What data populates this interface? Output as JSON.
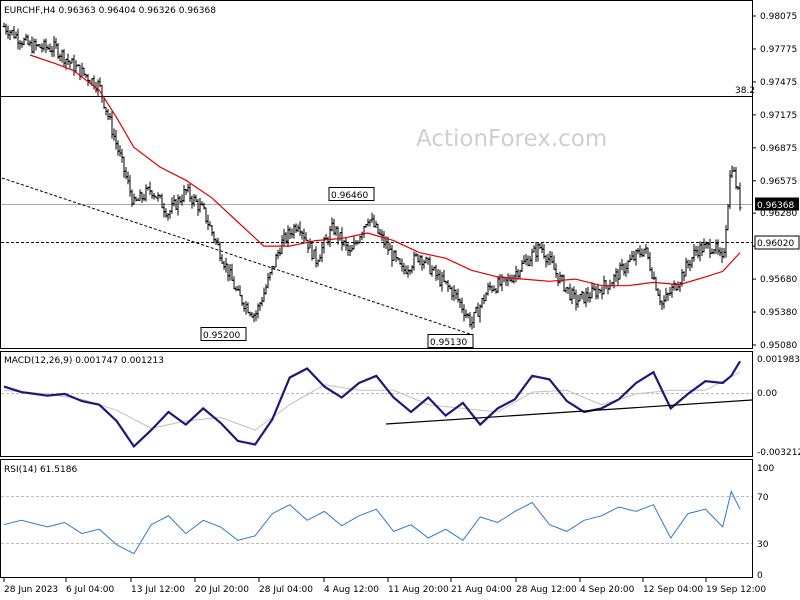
{
  "chart_data": [
    {
      "type": "candlestick",
      "panel": "price",
      "title": "EURCHF,H4  0.96363 0.96404 0.96326 0.96368",
      "watermark": "ActionForex.com",
      "y_ticks": [
        "0.98075",
        "0.97775",
        "0.97475",
        "0.97175",
        "0.96875",
        "0.96575",
        "0.96280",
        "0.95980",
        "0.95680",
        "0.95380",
        "0.95080"
      ],
      "ylim": [
        0.9508,
        0.9815
      ],
      "current_price": "0.96368",
      "annotations": [
        {
          "text": "0.96460",
          "value": 0.9646
        },
        {
          "text": "0.95200",
          "value": 0.952
        },
        {
          "text": "0.95130",
          "value": 0.9513
        },
        {
          "text": "0.96020",
          "value": 0.9602
        },
        {
          "text": "38.2",
          "value": 0.9737
        }
      ],
      "horizontal_lines": [
        {
          "value": 0.9737,
          "style": "solid",
          "label": "38.2"
        },
        {
          "value": 0.9602,
          "style": "dashed",
          "label": "0.96020"
        }
      ],
      "trendline": {
        "from": {
          "date": "28 Jun 2023",
          "value": 0.9655
        },
        "to": {
          "date": "25 Aug 2023",
          "value": 0.9513
        },
        "style": "dashed"
      },
      "moving_average_color": "#e00000",
      "candle_color": "#000000"
    },
    {
      "type": "line",
      "panel": "macd",
      "title": "MACD(12,26,9) 0.001747 0.001213",
      "y_ticks": [
        "0.001983",
        "0.00",
        "-0.003212"
      ],
      "ylim": [
        -0.00335,
        0.00215
      ],
      "macd_color": "#1a1a7a",
      "signal_color": "#c0c0c0",
      "trendline": {
        "from": {
          "date": "9 Aug 2023",
          "value": -0.0022
        },
        "to": {
          "date": "21 Sep 2023",
          "value": -0.0006
        }
      }
    },
    {
      "type": "line",
      "panel": "rsi",
      "title": "RSI(14) 61.5186",
      "y_ticks": [
        "100",
        "70",
        "30",
        "0"
      ],
      "ylim": [
        0,
        100
      ],
      "levels": [
        70,
        30
      ],
      "line_color": "#2b7bc8"
    }
  ],
  "x_axis": {
    "ticks": [
      "28 Jun 2023",
      "6 Jul 04:00",
      "13 Jul 12:00",
      "20 Jul 20:00",
      "28 Jul 04:00",
      "4 Aug 12:00",
      "11 Aug 20:00",
      "21 Aug 04:00",
      "28 Aug 12:00",
      "4 Sep 20:00",
      "12 Sep 04:00",
      "19 Sep 12:00"
    ]
  },
  "price_path": [
    [
      "28 Jun 2023",
      0.9798
    ],
    [
      "1 Jul",
      0.978
    ],
    [
      "4 Jul",
      0.9778
    ],
    [
      "6 Jul",
      0.9762
    ],
    [
      "9 Jul",
      0.9744
    ],
    [
      "11 Jul",
      0.969
    ],
    [
      "13 Jul",
      0.9636
    ],
    [
      "15 Jul",
      0.965
    ],
    [
      "17 Jul",
      0.9628
    ],
    [
      "19 Jul",
      0.9648
    ],
    [
      "21 Jul",
      0.963
    ],
    [
      "23 Jul",
      0.9592
    ],
    [
      "25 Jul",
      0.9553
    ],
    [
      "27 Jul",
      0.9535
    ],
    [
      "28 Jul",
      0.9555
    ],
    [
      "30 Jul",
      0.96
    ],
    [
      "1 Aug",
      0.962
    ],
    [
      "3 Aug",
      0.9585
    ],
    [
      "5 Aug",
      0.9615
    ],
    [
      "7 Aug",
      0.959
    ],
    [
      "9 Aug",
      0.9625
    ],
    [
      "11 Aug",
      0.96
    ],
    [
      "13 Aug",
      0.9575
    ],
    [
      "15 Aug",
      0.959
    ],
    [
      "17 Aug",
      0.957
    ],
    [
      "19 Aug",
      0.9555
    ],
    [
      "21 Aug",
      0.9528
    ],
    [
      "23 Aug",
      0.956
    ],
    [
      "25 Aug",
      0.9565
    ],
    [
      "27 Aug",
      0.9582
    ],
    [
      "29 Aug",
      0.9598
    ],
    [
      "31 Aug",
      0.957
    ],
    [
      "2 Sep",
      0.9548
    ],
    [
      "4 Sep",
      0.9555
    ],
    [
      "6 Sep",
      0.9565
    ],
    [
      "8 Sep",
      0.9582
    ],
    [
      "10 Sep",
      0.9596
    ],
    [
      "12 Sep",
      0.9545
    ],
    [
      "14 Sep",
      0.9568
    ],
    [
      "16 Sep",
      0.9595
    ],
    [
      "18 Sep",
      0.9598
    ],
    [
      "19 Sep",
      0.9582
    ],
    [
      "20 Sep",
      0.9675
    ],
    [
      "21 Sep",
      0.9637
    ]
  ],
  "ma_path": [
    [
      "1 Jul",
      0.9772
    ],
    [
      "4 Jul",
      0.9764
    ],
    [
      "6 Jul",
      0.9758
    ],
    [
      "9 Jul",
      0.974
    ],
    [
      "11 Jul",
      0.9715
    ],
    [
      "13 Jul",
      0.9688
    ],
    [
      "16 Jul",
      0.967
    ],
    [
      "19 Jul",
      0.9658
    ],
    [
      "22 Jul",
      0.9642
    ],
    [
      "25 Jul",
      0.962
    ],
    [
      "28 Jul",
      0.9598
    ],
    [
      "31 Jul",
      0.9598
    ],
    [
      "3 Aug",
      0.9603
    ],
    [
      "6 Aug",
      0.9605
    ],
    [
      "9 Aug",
      0.961
    ],
    [
      "12 Aug",
      0.9603
    ],
    [
      "15 Aug",
      0.9592
    ],
    [
      "18 Aug",
      0.9587
    ],
    [
      "21 Aug",
      0.9576
    ],
    [
      "24 Aug",
      0.957
    ],
    [
      "27 Aug",
      0.9568
    ],
    [
      "30 Aug",
      0.9566
    ],
    [
      "2 Sep",
      0.9568
    ],
    [
      "5 Sep",
      0.9562
    ],
    [
      "8 Sep",
      0.9562
    ],
    [
      "11 Sep",
      0.9565
    ],
    [
      "14 Sep",
      0.9563
    ],
    [
      "17 Sep",
      0.957
    ],
    [
      "19 Sep",
      0.9575
    ],
    [
      "21 Sep",
      0.9592
    ]
  ],
  "macd_path": [
    [
      "28 Jun 2023",
      0.0004
    ],
    [
      "30 Jun",
      0.0001
    ],
    [
      "3 Jul",
      -0.0001
    ],
    [
      "5 Jul",
      0.0
    ],
    [
      "7 Jul",
      -0.0004
    ],
    [
      "9 Jul",
      -0.0006
    ],
    [
      "11 Jul",
      -0.0015
    ],
    [
      "13 Jul",
      -0.0029
    ],
    [
      "15 Jul",
      -0.002
    ],
    [
      "17 Jul",
      -0.001
    ],
    [
      "19 Jul",
      -0.0017
    ],
    [
      "21 Jul",
      -0.0008
    ],
    [
      "23 Jul",
      -0.0016
    ],
    [
      "25 Jul",
      -0.0026
    ],
    [
      "27 Jul",
      -0.0028
    ],
    [
      "29 Jul",
      -0.0014
    ],
    [
      "31 Jul",
      0.0009
    ],
    [
      "2 Aug",
      0.0014
    ],
    [
      "4 Aug",
      0.0004
    ],
    [
      "6 Aug",
      -0.0002
    ],
    [
      "8 Aug",
      0.0006
    ],
    [
      "10 Aug",
      0.001
    ],
    [
      "12 Aug",
      -0.0002
    ],
    [
      "14 Aug",
      -0.001
    ],
    [
      "16 Aug",
      -0.0002
    ],
    [
      "18 Aug",
      -0.0012
    ],
    [
      "20 Aug",
      -0.0005
    ],
    [
      "22 Aug",
      -0.0017
    ],
    [
      "24 Aug",
      -0.0008
    ],
    [
      "26 Aug",
      -0.0003
    ],
    [
      "28 Aug",
      0.001
    ],
    [
      "30 Aug",
      0.0008
    ],
    [
      "1 Sep",
      -0.0004
    ],
    [
      "3 Sep",
      -0.001
    ],
    [
      "5 Sep",
      -0.0008
    ],
    [
      "7 Sep",
      -0.0003
    ],
    [
      "9 Sep",
      0.0006
    ],
    [
      "11 Sep",
      0.0012
    ],
    [
      "13 Sep",
      -0.0008
    ],
    [
      "15 Sep",
      0.0
    ],
    [
      "17 Sep",
      0.0007
    ],
    [
      "19 Sep",
      0.0006
    ],
    [
      "20 Sep",
      0.001
    ],
    [
      "21 Sep",
      0.0018
    ]
  ],
  "signal_path": [
    [
      "28 Jun 2023",
      0.0002
    ],
    [
      "3 Jul",
      0.0
    ],
    [
      "7 Jul",
      -0.0003
    ],
    [
      "11 Jul",
      -0.0009
    ],
    [
      "15 Jul",
      -0.0019
    ],
    [
      "19 Jul",
      -0.0015
    ],
    [
      "23 Jul",
      -0.0013
    ],
    [
      "27 Jul",
      -0.002
    ],
    [
      "31 Jul",
      -0.0006
    ],
    [
      "4 Aug",
      0.0005
    ],
    [
      "8 Aug",
      0.0002
    ],
    [
      "12 Aug",
      0.0002
    ],
    [
      "16 Aug",
      -0.0006
    ],
    [
      "20 Aug",
      -0.0008
    ],
    [
      "24 Aug",
      -0.001
    ],
    [
      "28 Aug",
      0.0001
    ],
    [
      "1 Sep",
      0.0002
    ],
    [
      "5 Sep",
      -0.0006
    ],
    [
      "9 Sep",
      0.0
    ],
    [
      "13 Sep",
      0.0002
    ],
    [
      "17 Sep",
      0.0002
    ],
    [
      "21 Sep",
      0.0012
    ]
  ],
  "rsi_path": [
    [
      "28 Jun 2023",
      48
    ],
    [
      "30 Jun",
      52
    ],
    [
      "3 Jul",
      46
    ],
    [
      "5 Jul",
      50
    ],
    [
      "7 Jul",
      40
    ],
    [
      "9 Jul",
      44
    ],
    [
      "11 Jul",
      30
    ],
    [
      "13 Jul",
      22
    ],
    [
      "15 Jul",
      48
    ],
    [
      "17 Jul",
      56
    ],
    [
      "19 Jul",
      40
    ],
    [
      "21 Jul",
      52
    ],
    [
      "23 Jul",
      46
    ],
    [
      "25 Jul",
      34
    ],
    [
      "27 Jul",
      38
    ],
    [
      "29 Jul",
      58
    ],
    [
      "31 Jul",
      66
    ],
    [
      "2 Aug",
      52
    ],
    [
      "4 Aug",
      60
    ],
    [
      "6 Aug",
      47
    ],
    [
      "8 Aug",
      56
    ],
    [
      "10 Aug",
      62
    ],
    [
      "12 Aug",
      42
    ],
    [
      "14 Aug",
      48
    ],
    [
      "16 Aug",
      36
    ],
    [
      "18 Aug",
      44
    ],
    [
      "20 Aug",
      34
    ],
    [
      "22 Aug",
      55
    ],
    [
      "24 Aug",
      50
    ],
    [
      "26 Aug",
      60
    ],
    [
      "28 Aug",
      68
    ],
    [
      "30 Aug",
      48
    ],
    [
      "1 Sep",
      42
    ],
    [
      "3 Sep",
      52
    ],
    [
      "5 Sep",
      56
    ],
    [
      "7 Sep",
      64
    ],
    [
      "9 Sep",
      60
    ],
    [
      "11 Sep",
      66
    ],
    [
      "13 Sep",
      36
    ],
    [
      "15 Sep",
      58
    ],
    [
      "17 Sep",
      62
    ],
    [
      "19 Sep",
      46
    ],
    [
      "20 Sep",
      78
    ],
    [
      "21 Sep",
      62
    ]
  ]
}
